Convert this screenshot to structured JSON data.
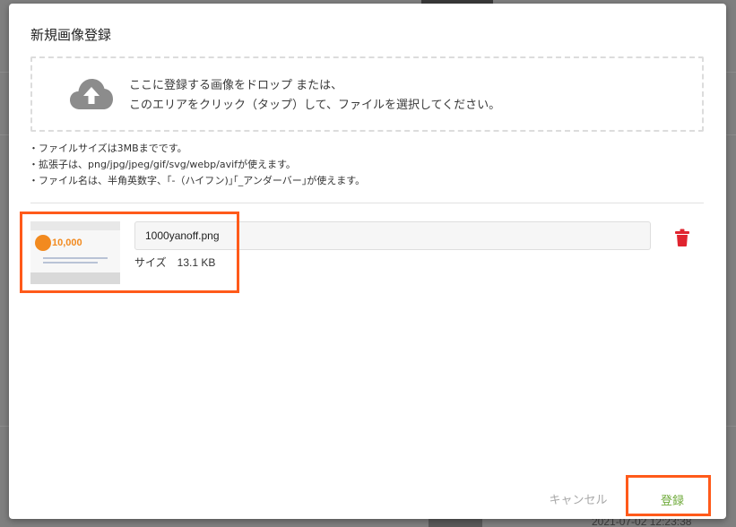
{
  "background": {
    "timestamp": "2021-07-02 12:23:38"
  },
  "modal": {
    "title": "新規画像登録",
    "dropzone": {
      "icon": "cloud-upload-icon",
      "line1": "ここに登録する画像をドロップ または、",
      "line2": "このエリアをクリック（タップ）して、ファイルを選択してください。"
    },
    "notes": [
      "・ファイルサイズは3MBまでです。",
      "・拡張子は、png/jpg/jpeg/gif/svg/webp/avifが使えます。",
      "・ファイル名は、半角英数字、｢-（ハイフン)｣｢_アンダーバー｣が使えます。"
    ],
    "file": {
      "thumbnail_text": "10,000",
      "name": "1000yanoff.png",
      "size_label": "サイズ",
      "size_value": "13.1 KB",
      "delete_icon": "trash-icon"
    },
    "footer": {
      "cancel_label": "キャンセル",
      "submit_label": "登録"
    }
  },
  "colors": {
    "highlight": "#ff5a1a",
    "delete": "#e0242f",
    "submit": "#6eaa3a",
    "cancel": "#a8a8a8",
    "upload_icon": "#8c8c8c"
  }
}
